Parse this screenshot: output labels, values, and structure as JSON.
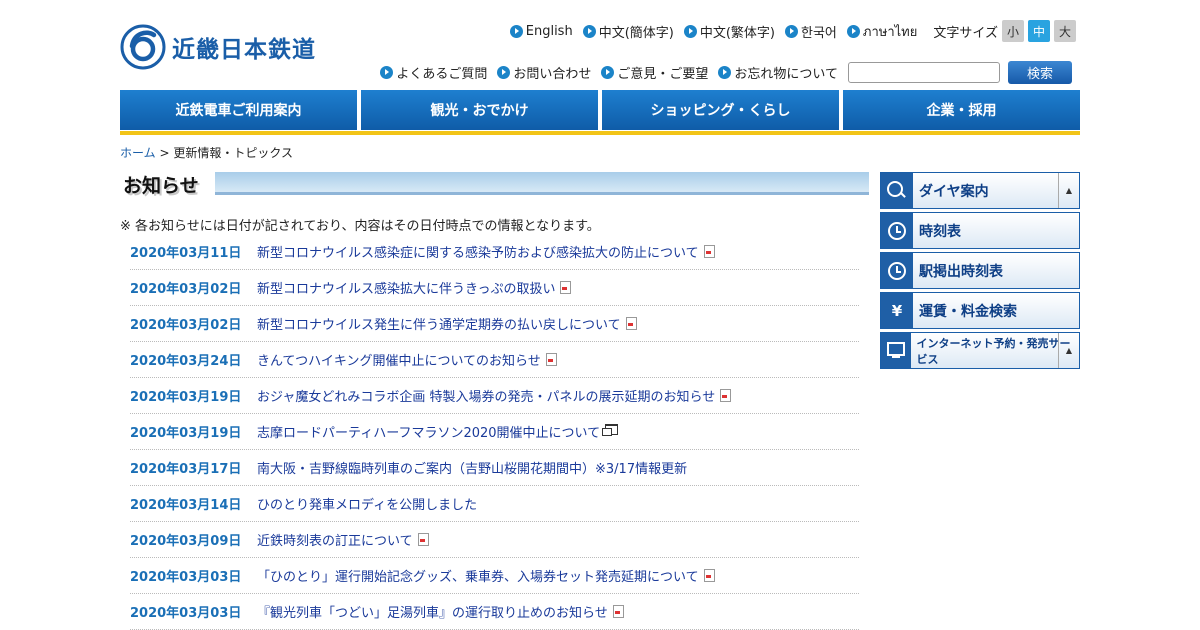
{
  "header": {
    "logo_text": "近畿日本鉄道",
    "languages": [
      "English",
      "中文(簡体字)",
      "中文(繁体字)",
      "한국어",
      "ภาษาไทย"
    ],
    "font_size_label": "文字サイズ",
    "font_sizes": [
      "小",
      "中",
      "大"
    ],
    "font_size_selected": "中",
    "util_links": [
      "よくあるご質問",
      "お問い合わせ",
      "ご意見・ご要望",
      "お忘れ物について"
    ],
    "search_value": "",
    "search_button": "検索"
  },
  "gnav": [
    "近鉄電車ご利用案内",
    "観光・おでかけ",
    "ショッピング・くらし",
    "企業・採用"
  ],
  "breadcrumb": {
    "home": "ホーム",
    "separator": ">",
    "current": "更新情報・トピックス"
  },
  "page_title": "お知らせ",
  "note": "※ 各お知らせには日付が記されており、内容はその日付時点での情報となります。",
  "news": [
    {
      "date": "2020年03月11日",
      "title": "新型コロナウイルス感染症に関する感染予防および感染拡大の防止について",
      "icon": "pdf-icon"
    },
    {
      "date": "2020年03月02日",
      "title": "新型コロナウイルス感染拡大に伴うきっぷの取扱い",
      "icon": "pdf-icon"
    },
    {
      "date": "2020年03月02日",
      "title": "新型コロナウイルス発生に伴う通学定期券の払い戻しについて",
      "icon": "pdf-icon"
    },
    {
      "date": "2020年03月24日",
      "title": "きんてつハイキング開催中止についてのお知らせ",
      "icon": "pdf-icon"
    },
    {
      "date": "2020年03月19日",
      "title": "おジャ魔女どれみコラボ企画 特製入場券の発売・パネルの展示延期のお知らせ",
      "icon": "pdf-icon"
    },
    {
      "date": "2020年03月19日",
      "title": "志摩ロードパーティハーフマラソン2020開催中止について",
      "icon": "new-window-icon"
    },
    {
      "date": "2020年03月17日",
      "title": "南大阪・吉野線臨時列車のご案内（吉野山桜開花期間中）※3/17情報更新",
      "icon": ""
    },
    {
      "date": "2020年03月14日",
      "title": "ひのとり発車メロディを公開しました",
      "icon": ""
    },
    {
      "date": "2020年03月09日",
      "title": "近鉄時刻表の訂正について",
      "icon": "pdf-icon"
    },
    {
      "date": "2020年03月03日",
      "title": "「ひのとり」運行開始記念グッズ、乗車券、入場券セット発売延期について",
      "icon": "pdf-icon"
    },
    {
      "date": "2020年03月03日",
      "title": "『観光列車「つどい」足湯列車』の運行取り止めのお知らせ",
      "icon": "pdf-icon"
    }
  ],
  "side_menu": [
    {
      "label": "ダイヤ案内",
      "icon": "search-icon",
      "expandable": true
    },
    {
      "label": "時刻表",
      "icon": "clock-icon",
      "expandable": false
    },
    {
      "label": "駅掲出時刻表",
      "icon": "clock-icon",
      "expandable": false
    },
    {
      "label": "運賃・料金検索",
      "icon": "yen-icon",
      "expandable": false
    },
    {
      "label": "インターネット予約・発売サービス",
      "icon": "monitor-icon",
      "expandable": true
    }
  ],
  "colors": {
    "brand": "#1a5ea8",
    "nav": "#1367b8",
    "accent_bar": "#f2c418",
    "date": "#1a6fb6"
  }
}
